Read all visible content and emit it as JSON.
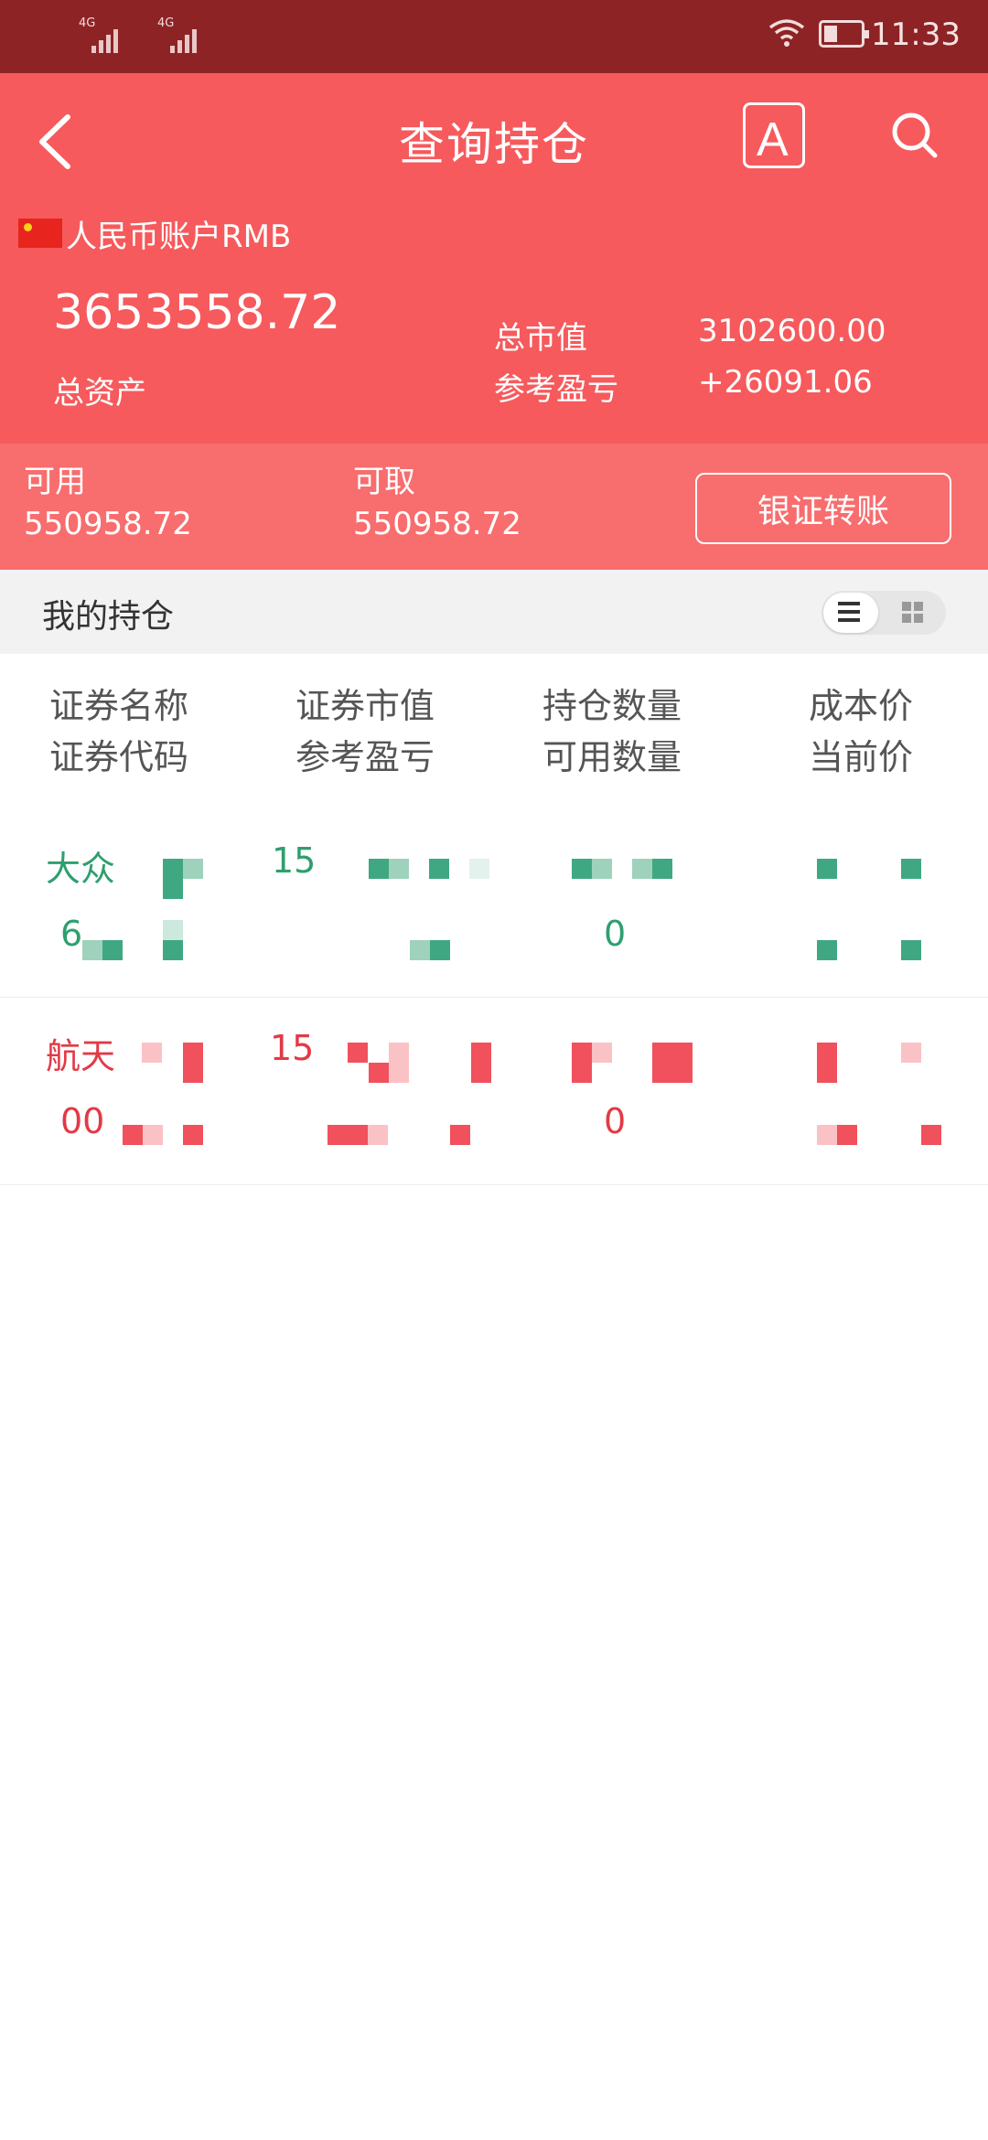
{
  "status_bar": {
    "network_1": "4G",
    "network_2": "4G",
    "time": "11:33"
  },
  "header": {
    "title": "查询持仓",
    "font_button": "A",
    "account_label": "人民币账户RMB",
    "total_assets_value": "3653558.72",
    "total_assets_label": "总资产",
    "market_value_label": "总市值",
    "market_value": "3102600.00",
    "profit_label": "参考盈亏",
    "profit_value": "+26091.06"
  },
  "funds": {
    "available_label": "可用",
    "available_value": "550958.72",
    "withdrawable_label": "可取",
    "withdrawable_value": "550958.72",
    "transfer_button": "银证转账"
  },
  "section": {
    "title": "我的持仓"
  },
  "table": {
    "headers": [
      {
        "line1": "证券名称",
        "line2": "证券代码"
      },
      {
        "line1": "证券市值",
        "line2": "参考盈亏"
      },
      {
        "line1": "持仓数量",
        "line2": "可用数量"
      },
      {
        "line1": "成本价",
        "line2": "当前价"
      }
    ],
    "rows": [
      {
        "name": "大众",
        "code": "6",
        "market_value": "15",
        "quantity": "0",
        "color": "#2e9f6e"
      },
      {
        "name": "航天",
        "code": "00",
        "market_value": "15",
        "quantity": "0",
        "color": "#e23a46"
      }
    ]
  },
  "colors": {
    "status_bar": "#8e2325",
    "header": "#f65a5c",
    "funds": "#f86d6e",
    "gain_green": "#2e9f6e",
    "loss_red": "#e23a46"
  },
  "icons": [
    "back-chevron-icon",
    "font-size-icon",
    "search-icon",
    "china-flag-icon",
    "list-view-icon",
    "grid-view-icon",
    "wifi-icon",
    "battery-icon",
    "signal-icon"
  ]
}
